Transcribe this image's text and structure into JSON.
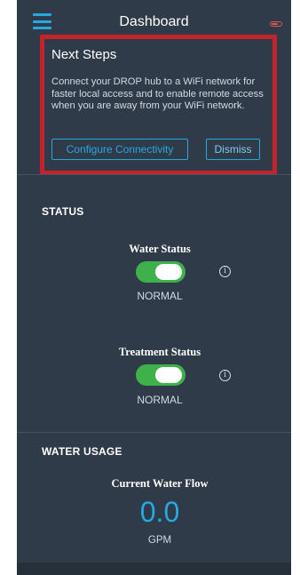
{
  "header": {
    "title": "Dashboard",
    "menu_icon": "hamburger-menu-icon",
    "battery_icon": "battery-low-icon"
  },
  "next_steps": {
    "heading": "Next Steps",
    "message": "Connect your DROP hub to a WiFi network for faster local access and to enable remote access when you are away from your WiFi network.",
    "configure_label": "Configure Connectivity",
    "dismiss_label": "Dismiss"
  },
  "status": {
    "section_label": "STATUS",
    "water_status": {
      "label": "Water Status",
      "value": "NORMAL",
      "toggle_on": true
    },
    "treatment_status": {
      "label": "Treatment Status",
      "value": "NORMAL",
      "toggle_on": true
    },
    "info_icon_glyph": "i"
  },
  "water_usage": {
    "section_label": "WATER USAGE",
    "flow_label": "Current Water Flow",
    "flow_value": "0.0",
    "flow_unit": "GPM"
  },
  "colors": {
    "background": "#2f3b48",
    "accent": "#27a8e0",
    "toggle_on": "#3fb14a",
    "highlight_border": "#c4232b"
  }
}
